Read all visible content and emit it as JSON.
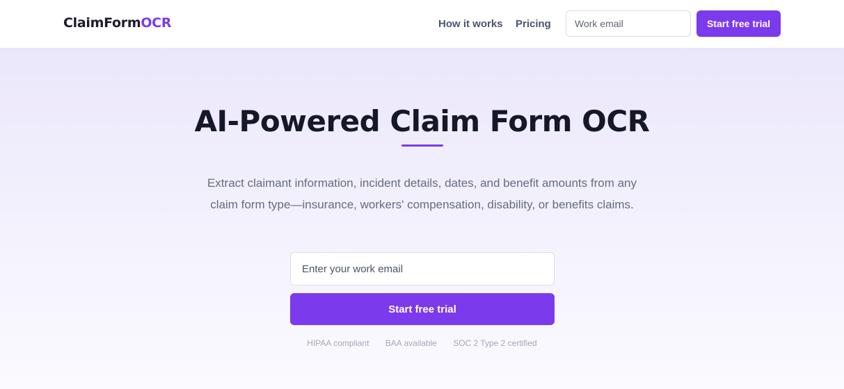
{
  "nav": {
    "logo_main": "ClaimForm",
    "logo_accent": "OCR",
    "links": [
      "How it works",
      "Pricing"
    ],
    "email_placeholder": "Work email",
    "cta_label": "Start free trial"
  },
  "hero": {
    "title": "AI-Powered Claim Form OCR",
    "subtitle": "Extract claimant information, incident details, dates, and benefit amounts from any claim form type—insurance, workers' compensation, disability, or benefits claims.",
    "email_placeholder": "Enter your work email",
    "cta_label": "Start free trial",
    "badges": [
      "HIPAA compliant",
      "BAA available",
      "SOC 2 Type 2 certified"
    ]
  },
  "colors": {
    "accent": "#7c3aed",
    "hero_bg_top": "#ebe7fb",
    "text_dark": "#17172a",
    "text_muted": "#646b80"
  }
}
